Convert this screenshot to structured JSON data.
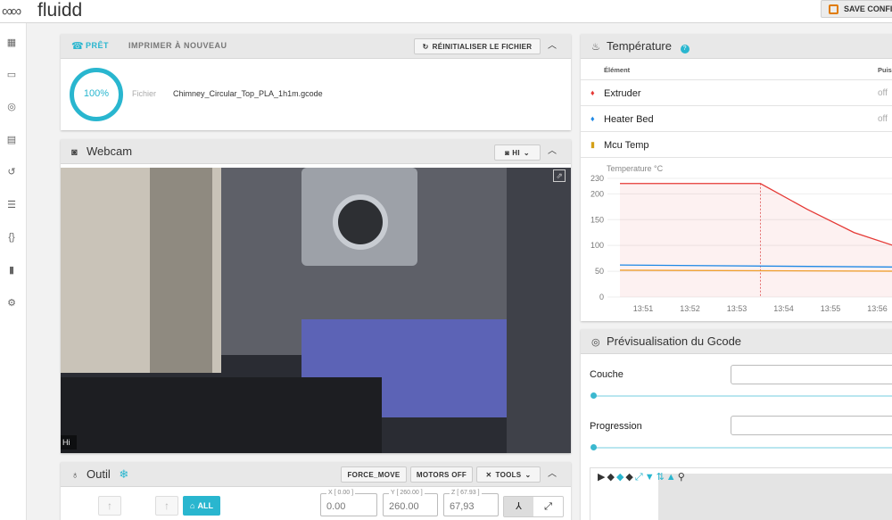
{
  "app": {
    "name": "fluidd",
    "save_label": "SAVE CONFIG"
  },
  "sidebar": {
    "icons": [
      "dashboard-icon",
      "console-icon",
      "gcode-preview-icon",
      "file-icon",
      "history-icon",
      "tune-icon",
      "macros-icon",
      "device-icon",
      "settings-icon"
    ]
  },
  "status": {
    "state": "PRÊT",
    "reprint": "IMPRIMER À NOUVEAU",
    "reset_label": "RÉINITIALISER LE FICHIER",
    "progress": "100%",
    "file_label": "Fichier",
    "file_name": "Chimney_Circular_Top_PLA_1h1m.gcode"
  },
  "webcam": {
    "title": "Webcam",
    "camera_name": "HI",
    "overlay_label": "Hi"
  },
  "tool": {
    "title": "Outil",
    "force_move": "FORCE_MOVE",
    "motors_off": "MOTORS OFF",
    "tools": "TOOLS",
    "home_all": "ALL",
    "x_label": "X [ 0.00 ]",
    "x_value": "0.00",
    "y_label": "Y [ 260.00 ]",
    "y_value": "260.00",
    "z_label": "Z [ 67.93 ]",
    "z_value": "67,93"
  },
  "temperature": {
    "title": "Température",
    "col_element": "Élément",
    "col_power": "Puissance",
    "rows": [
      {
        "name": "Extruder",
        "power": "off",
        "color": "#e53935"
      },
      {
        "name": "Heater Bed",
        "power": "off",
        "color": "#1e88e5"
      },
      {
        "name": "Mcu Temp",
        "power": "",
        "color": "#d4a017"
      }
    ]
  },
  "chart_data": {
    "type": "line",
    "ylabel": "Temperature °C",
    "x": [
      "13:51",
      "13:52",
      "13:53",
      "13:54",
      "13:55",
      "13:56"
    ],
    "y_ticks": [
      0,
      50,
      100,
      150,
      200,
      230
    ],
    "ylim": [
      0,
      230
    ],
    "series": [
      {
        "name": "Extruder",
        "color": "#e53935",
        "points": [
          [
            0,
            220
          ],
          [
            3,
            220
          ],
          [
            3.3,
            205
          ],
          [
            4,
            170
          ],
          [
            5,
            125
          ],
          [
            6,
            95
          ]
        ]
      },
      {
        "name": "Heater Bed",
        "color": "#1e88e5",
        "points": [
          [
            0,
            62
          ],
          [
            6,
            58
          ]
        ]
      },
      {
        "name": "Mcu Temp",
        "color": "#f0a030",
        "points": [
          [
            0,
            52
          ],
          [
            6,
            50
          ]
        ]
      }
    ]
  },
  "gcode_preview": {
    "title": "Prévisualisation du Gcode",
    "layer_label": "Couche",
    "progress_label": "Progression"
  },
  "colors": {
    "accent": "#29b6cf",
    "header": "#e8e8e8"
  }
}
